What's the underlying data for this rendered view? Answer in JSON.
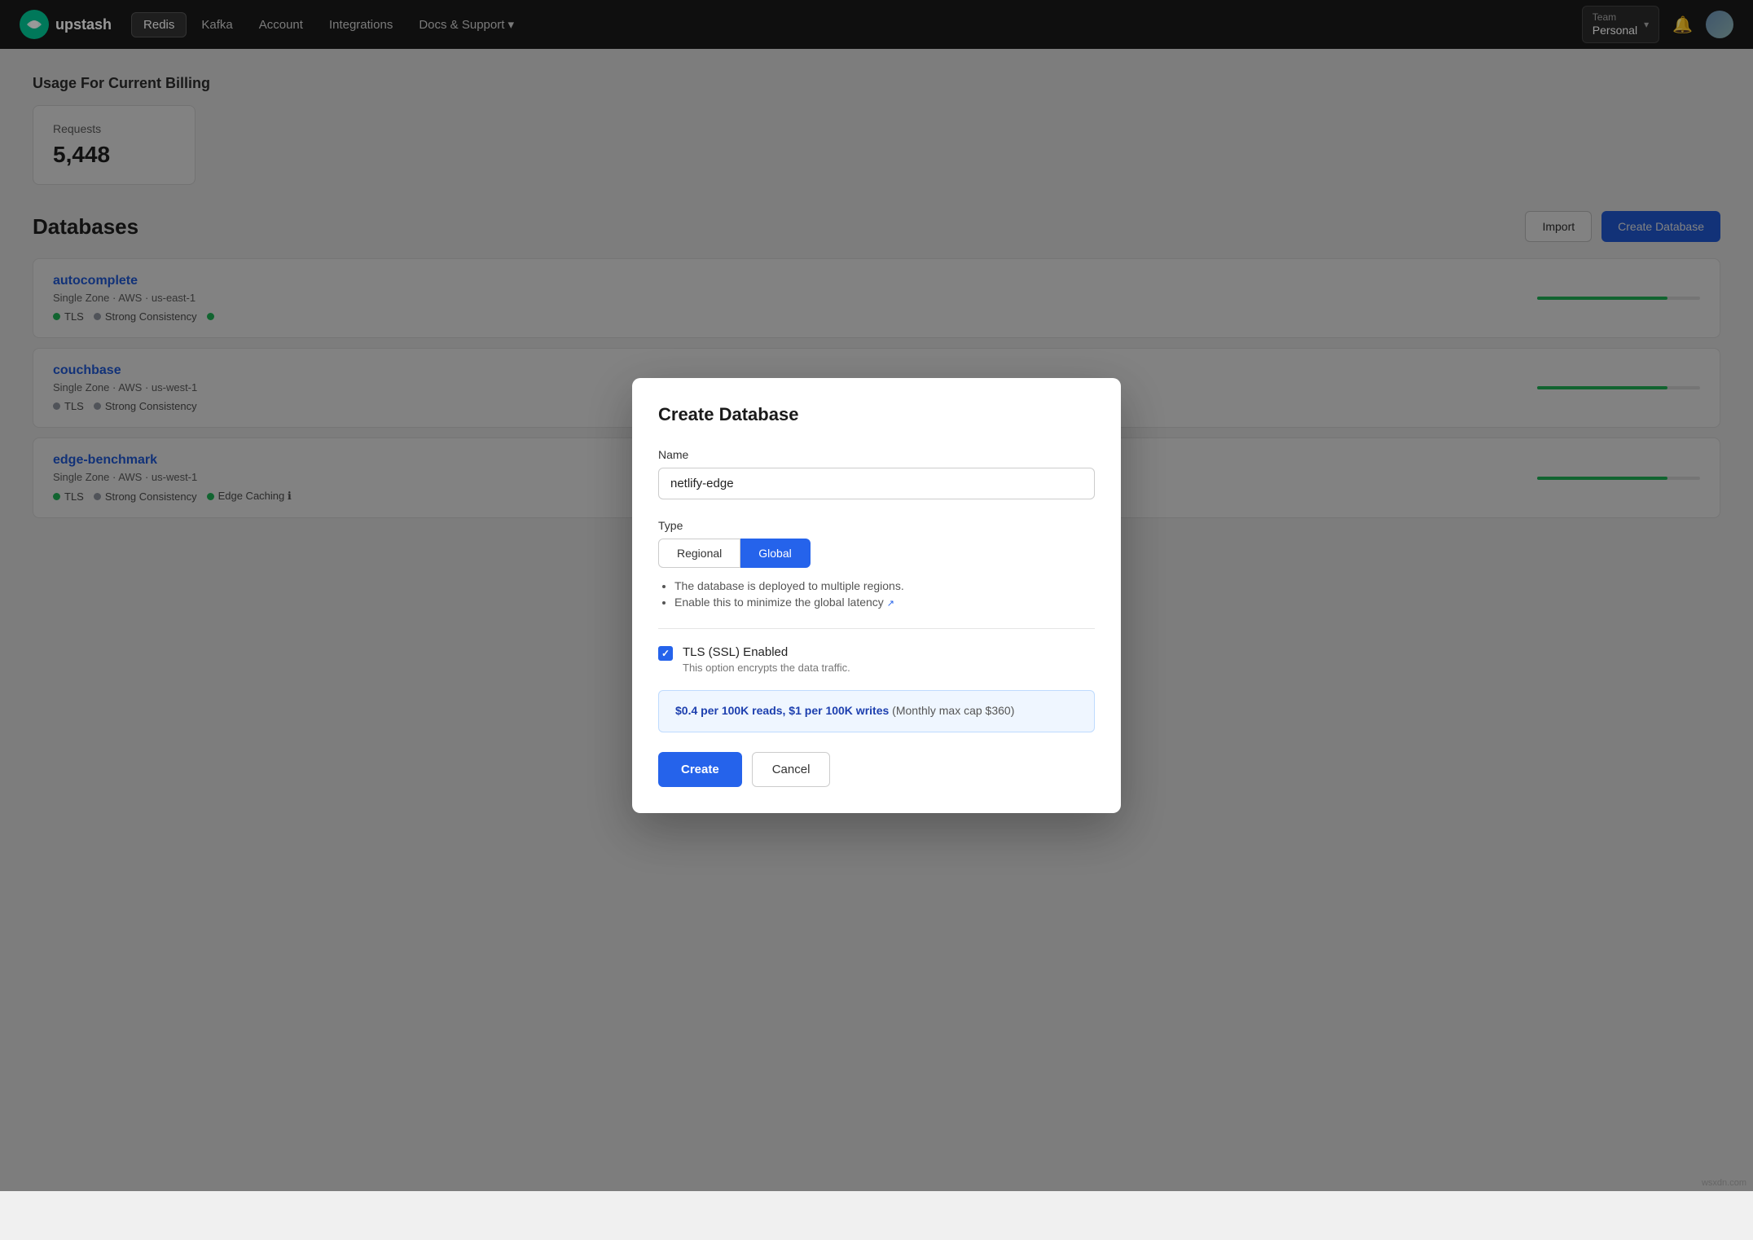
{
  "navbar": {
    "logo_text": "upstash",
    "items": [
      {
        "label": "Redis",
        "active": true
      },
      {
        "label": "Kafka",
        "active": false
      },
      {
        "label": "Account",
        "active": false
      },
      {
        "label": "Integrations",
        "active": false
      },
      {
        "label": "Docs & Support ▾",
        "active": false
      }
    ],
    "team_label": "Team",
    "team_name": "Personal",
    "bell_icon": "🔔",
    "chevron_icon": "▾"
  },
  "usage": {
    "section_title": "Usage For Current Billing",
    "requests_label": "Requests",
    "requests_value": "5,448"
  },
  "databases": {
    "section_title": "Databases",
    "import_btn": "Import",
    "create_btn": "Create Database",
    "items": [
      {
        "name": "autocomplete",
        "meta": "Single Zone · AWS · us-east-1",
        "tags": [
          {
            "dot": "green",
            "label": "TLS"
          },
          {
            "dot": "gray",
            "label": "Strong Consistency"
          },
          {
            "dot": "green",
            "label": ""
          }
        ]
      },
      {
        "name": "couchbase",
        "meta": "Single Zone · AWS · us-west-1",
        "tags": [
          {
            "dot": "gray",
            "label": "TLS"
          },
          {
            "dot": "gray",
            "label": "Strong Consistency"
          }
        ]
      },
      {
        "name": "edge-benchmark",
        "meta": "Single Zone · AWS · us-west-1",
        "tags": [
          {
            "dot": "green",
            "label": "TLS"
          },
          {
            "dot": "gray",
            "label": "Strong Consistency"
          },
          {
            "dot": "green",
            "label": "Edge Caching ℹ"
          }
        ]
      }
    ]
  },
  "modal": {
    "title": "Create Database",
    "name_label": "Name",
    "name_value": "netlify-edge",
    "name_placeholder": "netlify-edge",
    "type_label": "Type",
    "type_regional": "Regional",
    "type_global": "Global",
    "type_info_line1": "The database is deployed to multiple regions.",
    "type_info_line2": "Enable this to minimize the global latency",
    "tls_label": "TLS (SSL) Enabled",
    "tls_desc": "This option encrypts the data traffic.",
    "pricing_main": "$0.4 per 100K reads, $1 per 100K writes",
    "pricing_cap": "(Monthly max cap $360)",
    "create_btn": "Create",
    "cancel_btn": "Cancel"
  },
  "watermark": "wsxdn.com"
}
